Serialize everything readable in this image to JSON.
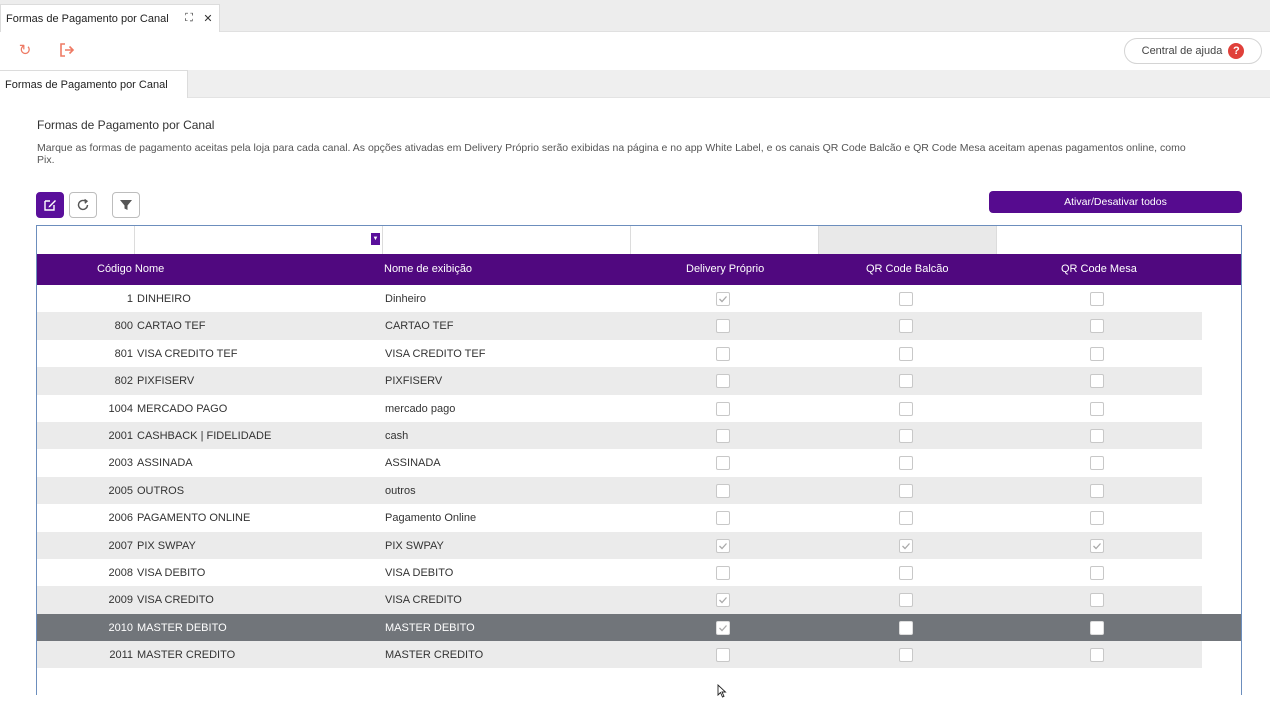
{
  "window_tab": {
    "title": "Formas de Pagamento por Canal",
    "expand_icon": "expand-icon",
    "close_icon": "close-icon",
    "expand_glyph": "⛶",
    "close_glyph": "✕"
  },
  "toolbar": {
    "help_label": "Central de ajuda",
    "help_glyph": "?",
    "refresh_glyph": "↻",
    "exit_glyph": "⇥"
  },
  "subtab": {
    "label": "Formas de Pagamento por Canal"
  },
  "section": {
    "title": "Formas de Pagamento por Canal",
    "description": "Marque as formas de pagamento aceitas pela loja para cada canal. As opções ativadas em Delivery Próprio serão exibidas na página e no app White Label, e os canais QR Code Balcão e QR Code Mesa aceitam apenas pagamentos online, como Pix."
  },
  "actions": {
    "toggle_all_label": "Ativar/Desativar todos"
  },
  "grid": {
    "columns": {
      "code_name": "Código Nome",
      "display_name": "Nome de exibição",
      "delivery": "Delivery Próprio",
      "qr_balcao": "QR Code Balcão",
      "qr_mesa": "QR Code Mesa"
    },
    "rows": [
      {
        "code": "1",
        "name": "DINHEIRO",
        "display": "Dinheiro",
        "delivery": true,
        "balcao": false,
        "mesa": false
      },
      {
        "code": "800",
        "name": "CARTAO TEF",
        "display": "CARTAO TEF",
        "delivery": false,
        "balcao": false,
        "mesa": false
      },
      {
        "code": "801",
        "name": "VISA CREDITO TEF",
        "display": "VISA CREDITO TEF",
        "delivery": false,
        "balcao": false,
        "mesa": false
      },
      {
        "code": "802",
        "name": "PIXFISERV",
        "display": "PIXFISERV",
        "delivery": false,
        "balcao": false,
        "mesa": false
      },
      {
        "code": "1004",
        "name": "MERCADO PAGO",
        "display": "mercado pago",
        "delivery": false,
        "balcao": false,
        "mesa": false
      },
      {
        "code": "2001",
        "name": "CASHBACK | FIDELIDADE",
        "display": "cash",
        "delivery": false,
        "balcao": false,
        "mesa": false
      },
      {
        "code": "2003",
        "name": "ASSINADA",
        "display": "ASSINADA",
        "delivery": false,
        "balcao": false,
        "mesa": false
      },
      {
        "code": "2005",
        "name": "OUTROS",
        "display": "outros",
        "delivery": false,
        "balcao": false,
        "mesa": false
      },
      {
        "code": "2006",
        "name": "PAGAMENTO ONLINE",
        "display": "Pagamento Online",
        "delivery": false,
        "balcao": false,
        "mesa": false
      },
      {
        "code": "2007",
        "name": "PIX SWPAY",
        "display": "PIX SWPAY",
        "delivery": true,
        "balcao": true,
        "mesa": true
      },
      {
        "code": "2008",
        "name": "VISA DEBITO",
        "display": "VISA DEBITO",
        "delivery": false,
        "balcao": false,
        "mesa": false
      },
      {
        "code": "2009",
        "name": "VISA CREDITO",
        "display": "VISA CREDITO",
        "delivery": true,
        "balcao": false,
        "mesa": false
      },
      {
        "code": "2010",
        "name": "MASTER DEBITO",
        "display": "MASTER DEBITO",
        "delivery": true,
        "balcao": false,
        "mesa": false,
        "selected": true
      },
      {
        "code": "2011",
        "name": "MASTER CREDITO",
        "display": "MASTER CREDITO",
        "delivery": false,
        "balcao": false,
        "mesa": false
      }
    ]
  },
  "colors": {
    "accent": "#50087f",
    "selected_row": "#71757a",
    "alt_row": "#ebebeb",
    "tool_icon": "#ee7a64"
  },
  "icons": {
    "edit": "edit-icon",
    "refresh": "refresh-icon",
    "filter": "filter-icon",
    "exit": "exit-icon",
    "help": "help-icon"
  }
}
